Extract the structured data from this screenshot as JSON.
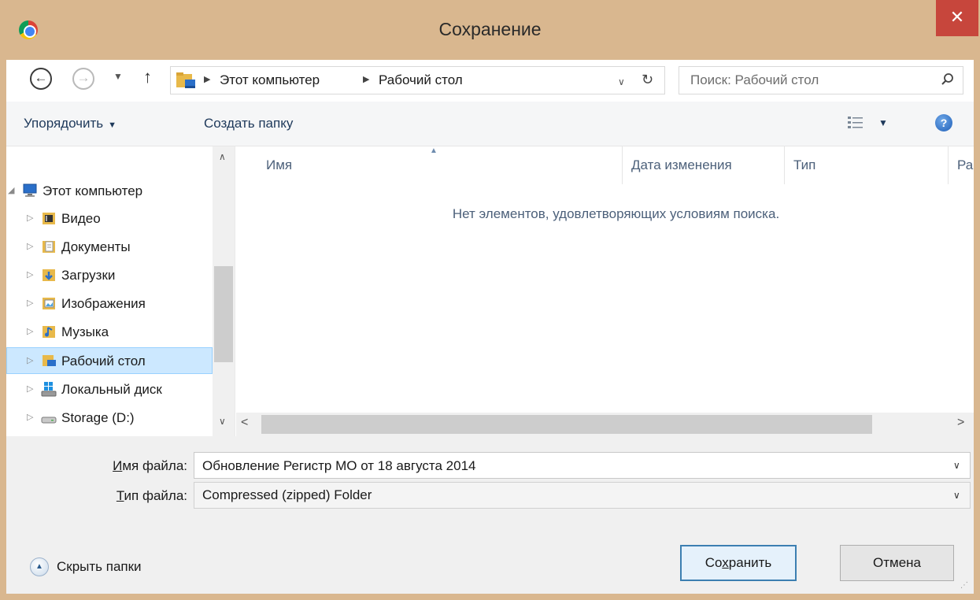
{
  "window": {
    "title": "Сохранение",
    "close_label": "✕"
  },
  "navigation": {
    "back_label": "←",
    "forward_label": "→",
    "recent_label": "▼",
    "up_label": "↑",
    "breadcrumbs": [
      "Этот компьютер",
      "Рабочий стол"
    ],
    "breadcrumb_separator": "▶",
    "address_dropdown": "∨",
    "refresh_label": "↻",
    "search_placeholder": "Поиск: Рабочий стол"
  },
  "toolbar": {
    "organize_label": "Упорядочить",
    "organize_caret": "▼",
    "new_folder_label": "Создать папку",
    "view_caret": "▼",
    "help_label": "?"
  },
  "tree": {
    "root": "Этот компьютер",
    "items": [
      {
        "label": "Видео",
        "icon": "video-folder-icon"
      },
      {
        "label": "Документы",
        "icon": "documents-folder-icon"
      },
      {
        "label": "Загрузки",
        "icon": "downloads-folder-icon"
      },
      {
        "label": "Изображения",
        "icon": "pictures-folder-icon"
      },
      {
        "label": "Музыка",
        "icon": "music-folder-icon"
      },
      {
        "label": "Рабочий стол",
        "icon": "desktop-folder-icon",
        "selected": true
      },
      {
        "label": "Локальный диск",
        "icon": "windows-drive-icon"
      },
      {
        "label": "Storage (D:)",
        "icon": "drive-icon"
      }
    ],
    "expander_label": "▷",
    "root_expander_label": "◢",
    "scroll_up": "∧",
    "scroll_down": "∨"
  },
  "filelist": {
    "columns": [
      "Имя",
      "Дата изменения",
      "Тип",
      "Ра"
    ],
    "sort_indicator": "▲",
    "empty_message": "Нет элементов, удовлетворяющих условиям поиска.",
    "scroll_left": "<",
    "scroll_right": ">"
  },
  "form": {
    "filename_label_accel": "И",
    "filename_label_rest": "мя файла:",
    "filename_value": "Обновление Регистр МО от 18 августа 2014",
    "filetype_label_accel": "Т",
    "filetype_label_rest": "ип файла:",
    "filetype_value": "Compressed (zipped) Folder",
    "dropdown_label": "∨"
  },
  "footer": {
    "hide_folders_label": "Скрыть папки",
    "hide_folders_glyph": "▲",
    "save_accel_pre": "Со",
    "save_accel": "х",
    "save_accel_post": "ранить",
    "cancel_label": "Отмена",
    "grip_label": "⋰"
  },
  "colors": {
    "frame": "#d9b78f",
    "close": "#c7463c",
    "selection": "#cce8ff",
    "link_text": "#1e395b"
  }
}
